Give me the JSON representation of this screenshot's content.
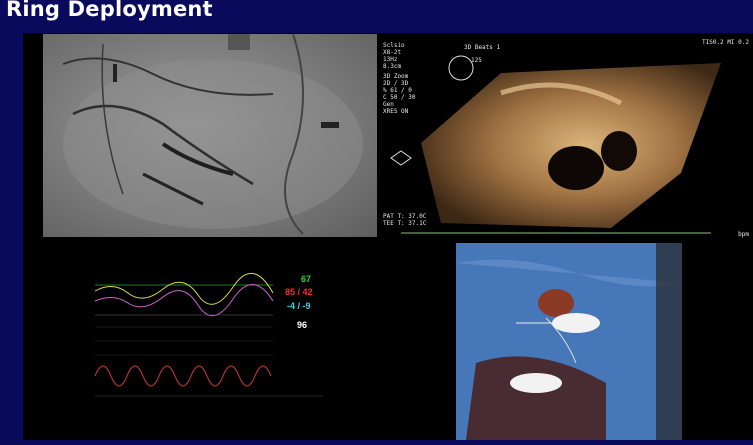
{
  "slide": {
    "title": "Ring Deployment"
  },
  "echo": {
    "brand": "Sclsio",
    "probe": "X8-2t",
    "rate": "13Hz",
    "depth": "8.3cm",
    "mode_label": "3D Beats 1",
    "tis": "TIS0.2",
    "mi": "MI 0.2",
    "zoom_title": "3D Zoom",
    "zoom_lines": [
      "2D / 3D",
      "% 61 / 0",
      "C 50 / 30",
      "Gen",
      "XRES ON"
    ],
    "angle": "125",
    "pat_temp": "PAT T: 37.0C",
    "tee_temp": "TEE T: 37.1C",
    "bpm": "bpm"
  },
  "monitor": {
    "hr": "67",
    "abp": "85 / 42",
    "pa": "-4 / -9",
    "spo2": "96"
  },
  "colors": {
    "background": "#0a0a5c",
    "hr": "#28d628",
    "abp": "#ff2a2a",
    "pa": "#3fd0e6"
  }
}
